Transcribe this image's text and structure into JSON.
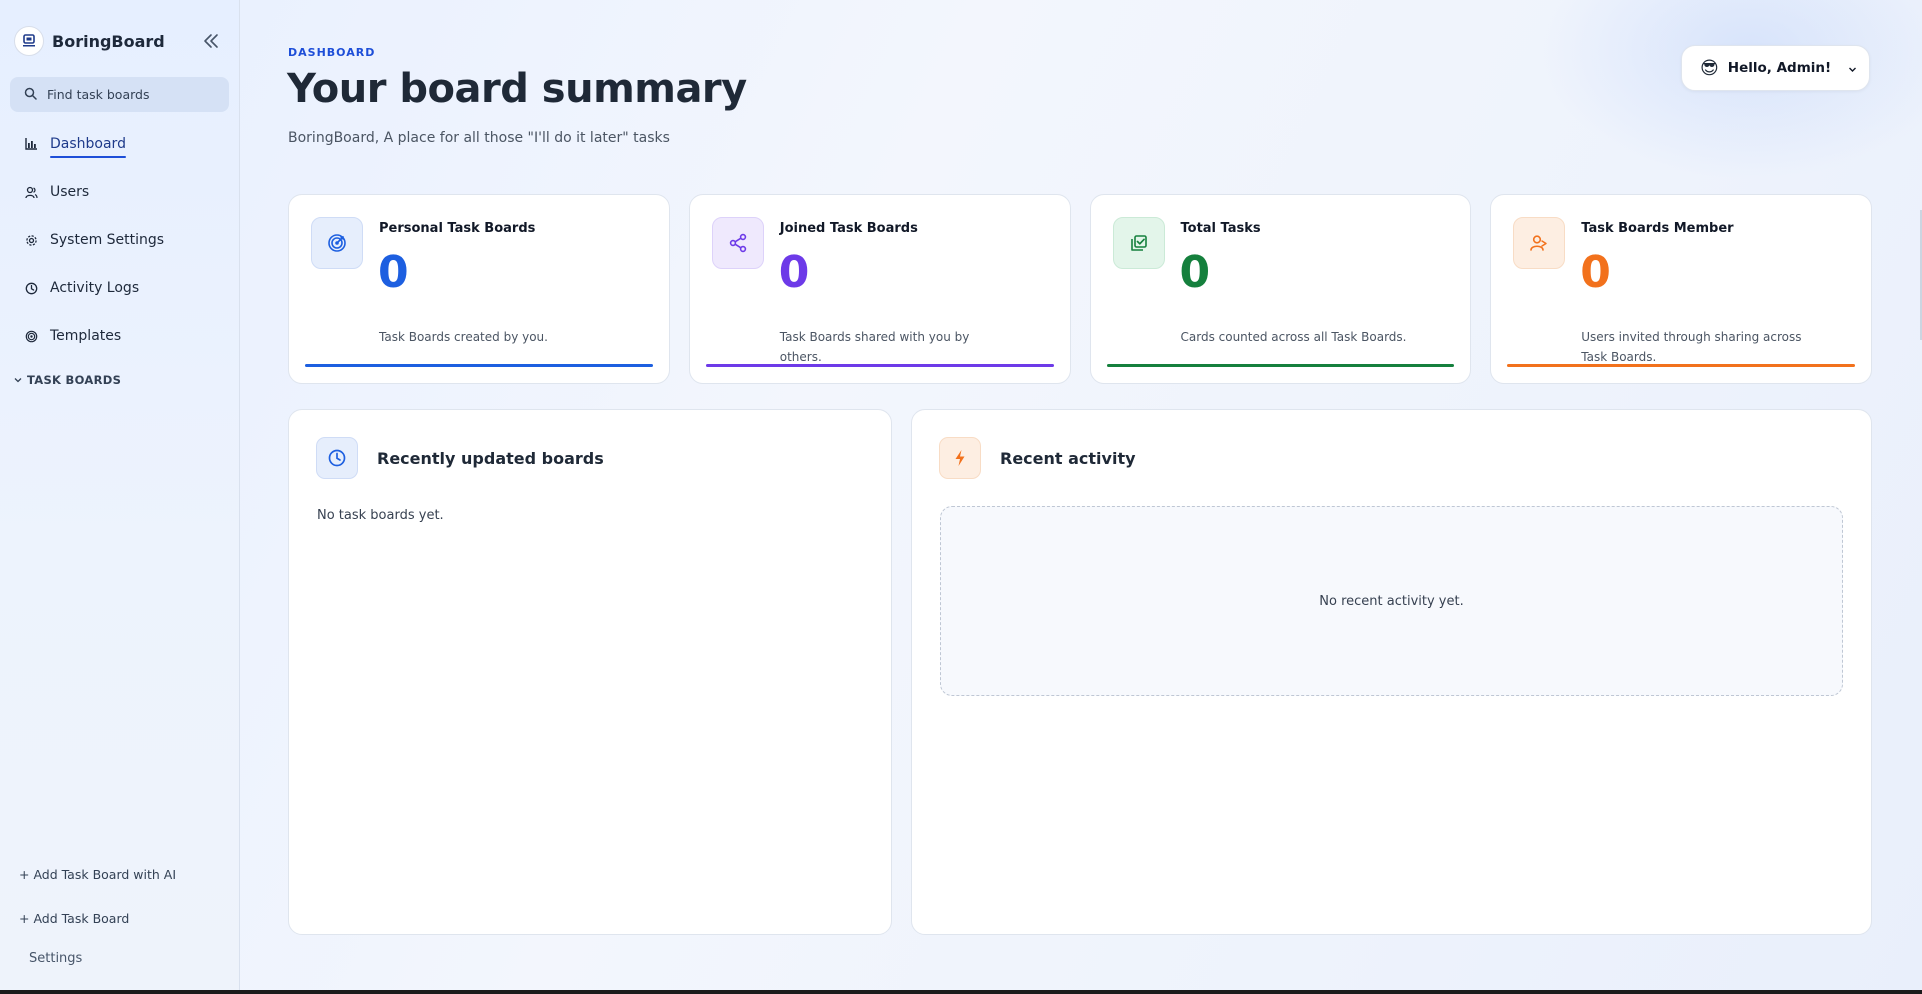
{
  "app": {
    "name": "BoringBoard"
  },
  "sidebar": {
    "search_placeholder": "Find task boards",
    "nav": [
      {
        "label": "Dashboard",
        "icon": "bar-chart-icon",
        "active": true
      },
      {
        "label": "Users",
        "icon": "users-icon"
      },
      {
        "label": "System Settings",
        "icon": "gear-icon"
      },
      {
        "label": "Activity Logs",
        "icon": "clock-icon"
      },
      {
        "label": "Templates",
        "icon": "target-icon"
      }
    ],
    "section_label": "TASK BOARDS",
    "add_ai_label": "+ Add Task Board with AI",
    "add_board_label": "+ Add Task Board",
    "settings_label": "Settings"
  },
  "header": {
    "eyebrow": "DASHBOARD",
    "title": "Your board summary",
    "subtitle": "BoringBoard, A place for all those \"I'll do it later\" tasks",
    "user_emoji": "😎",
    "user_greeting": "Hello, Admin!"
  },
  "stats": [
    {
      "title": "Personal Task Boards",
      "value": "0",
      "description": "Task Boards created by you.",
      "icon": "target-icon",
      "color": "#1d5fe0",
      "icon_bg": "#e6eefc"
    },
    {
      "title": "Joined Task Boards",
      "value": "0",
      "description": "Task Boards shared with you by others.",
      "icon": "share-icon",
      "color": "#6d3ae8",
      "icon_bg": "#efe9fd"
    },
    {
      "title": "Total Tasks",
      "value": "0",
      "description": "Cards counted across all Task Boards.",
      "icon": "checklist-icon",
      "color": "#15803d",
      "icon_bg": "#e3f5ea"
    },
    {
      "title": "Task Boards Member",
      "value": "0",
      "description": "Users invited through sharing across Task Boards.",
      "icon": "user-share-icon",
      "color": "#f2711c",
      "icon_bg": "#fdeee2"
    }
  ],
  "panels": {
    "recent_boards": {
      "title": "Recently updated boards",
      "empty_text": "No task boards yet.",
      "icon": "clock-icon",
      "icon_bg": "#e6eefc",
      "color": "#1d5fe0"
    },
    "recent_activity": {
      "title": "Recent activity",
      "empty_text": "No recent activity yet.",
      "icon": "lightning-icon",
      "icon_bg": "#fdeee2",
      "color": "#f2711c"
    }
  }
}
